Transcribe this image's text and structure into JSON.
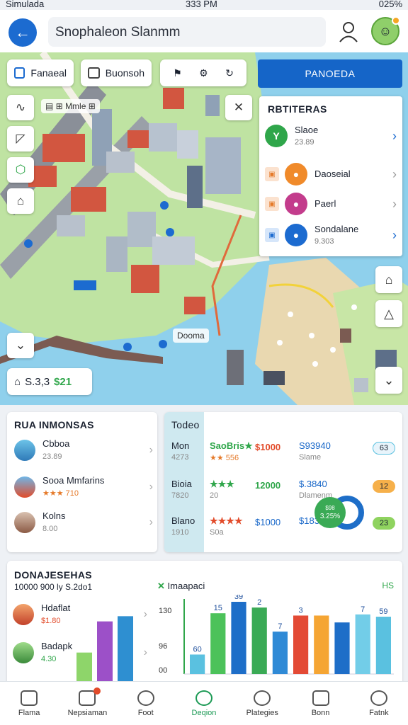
{
  "status": {
    "carrier": "Simulada",
    "time": "333 PM",
    "battery": "025%"
  },
  "topbar": {
    "search_text": "Snophaleon Slanmm"
  },
  "map": {
    "chips": [
      "Fanaeal",
      "Buonsoh"
    ],
    "primary_button": "PANOEDA",
    "labels": [
      "Mmle"
    ],
    "water_label": "Dooma",
    "price_pill": {
      "amount": "S.3,3",
      "value": "$21"
    },
    "results": {
      "title": "RBTITERAS",
      "items": [
        {
          "name": "Slaoe",
          "sub": "23.89"
        },
        {
          "name": "Daoseial",
          "sub": ""
        },
        {
          "name": "Paerl",
          "sub": ""
        },
        {
          "name": "Sondalane",
          "sub": "9.303"
        }
      ]
    }
  },
  "people_card": {
    "title": "RUA INMONSAS",
    "items": [
      {
        "name": "Cbboa",
        "sub": "23.89"
      },
      {
        "name": "Sooa Mmfarins",
        "sub": "★★★ 710"
      },
      {
        "name": "Kolns",
        "sub": "8.00"
      }
    ]
  },
  "compare_card": {
    "title": "Todeo",
    "rows": [
      {
        "label": "Mon",
        "sub": "4273",
        "rating": "SaoBris★",
        "rating_sub": "★★ 556",
        "price": "$1000",
        "alt": "S93940",
        "alt_sub": "Slame",
        "badge": "63",
        "badge_color": "#e8f4fb"
      },
      {
        "label": "Bioia",
        "sub": "7820",
        "rating": "★★★",
        "rating_sub": "20",
        "price": "12000",
        "alt": "$.3840",
        "alt_sub": "Dlamenm",
        "badge": "12",
        "badge_color": "#f6b04a"
      },
      {
        "label": "Blano",
        "sub": "1910",
        "rating": "★★★★",
        "rating_sub": "S0a",
        "price": "$1000",
        "alt": "$1839",
        "alt_sub": "",
        "badge": "23",
        "badge_color": "#8fd35f"
      }
    ],
    "donut": {
      "top": "$98",
      "value": "3.25%"
    }
  },
  "chart_card": {
    "title": "DONAJESEHAS",
    "subtitle": "10000 900 ly S.2do1",
    "persons": [
      {
        "name": "Hdaflat",
        "sub": "$1.80"
      },
      {
        "name": "Badapk",
        "sub": "4.30"
      }
    ]
  },
  "chart_data": [
    {
      "type": "bar",
      "categories": [
        "a",
        "b",
        "c"
      ],
      "values": [
        22,
        46,
        50
      ],
      "colors": [
        "#8ed56a",
        "#9c50c8",
        "#2e8fd1"
      ]
    },
    {
      "type": "bar",
      "title": "Imaapaci",
      "corner_label": "HS",
      "y_ticks": [
        "130",
        "96",
        "00"
      ],
      "categories": [
        "1",
        "2",
        "3",
        "4",
        "5",
        "6",
        "7",
        "8",
        "9",
        "10"
      ],
      "values": [
        17,
        53,
        63,
        58,
        37,
        51,
        51,
        45,
        52,
        50
      ],
      "labels": [
        "60",
        "15",
        "39",
        "2",
        "7",
        "3",
        "",
        "",
        "7",
        "59"
      ],
      "colors": [
        "#5ac1e0",
        "#4cc25a",
        "#1e6ec8",
        "#3aaa55",
        "#2f8ad6",
        "#e34a35",
        "#f5a533",
        "#1e6ec8",
        "#72cde8",
        "#5ac1e0"
      ]
    }
  ],
  "nav": [
    {
      "label": "Flama",
      "active": false
    },
    {
      "label": "Nepsiaman",
      "active": false
    },
    {
      "label": "Foot",
      "active": false
    },
    {
      "label": "Deqion",
      "active": true
    },
    {
      "label": "Plategies",
      "active": false
    },
    {
      "label": "Bonn",
      "active": false
    },
    {
      "label": "Fatnk",
      "active": false
    }
  ]
}
